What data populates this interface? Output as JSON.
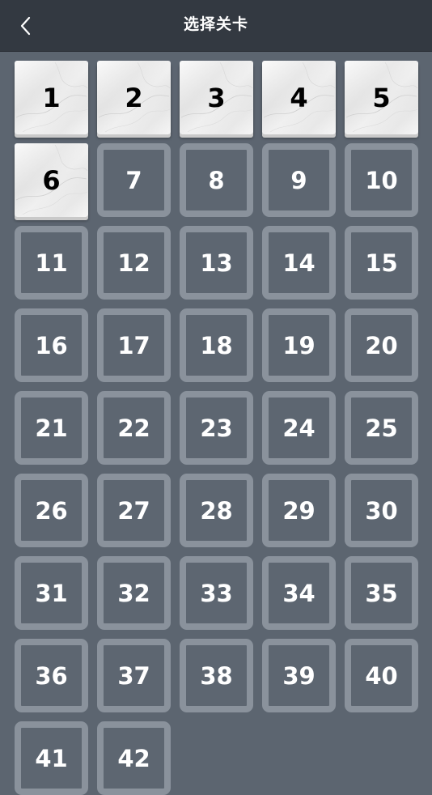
{
  "header": {
    "title": "选择关卡",
    "back_icon": "chevron-left-icon"
  },
  "colors": {
    "header_bg": "#333941",
    "page_bg": "#5c6570",
    "locked_border": "#8a929c",
    "unlocked_tile": "#f3f3f3"
  },
  "levels": [
    {
      "label": "1",
      "unlocked": true
    },
    {
      "label": "2",
      "unlocked": true
    },
    {
      "label": "3",
      "unlocked": true
    },
    {
      "label": "4",
      "unlocked": true
    },
    {
      "label": "5",
      "unlocked": true
    },
    {
      "label": "6",
      "unlocked": true
    },
    {
      "label": "7",
      "unlocked": false
    },
    {
      "label": "8",
      "unlocked": false
    },
    {
      "label": "9",
      "unlocked": false
    },
    {
      "label": "10",
      "unlocked": false
    },
    {
      "label": "11",
      "unlocked": false
    },
    {
      "label": "12",
      "unlocked": false
    },
    {
      "label": "13",
      "unlocked": false
    },
    {
      "label": "14",
      "unlocked": false
    },
    {
      "label": "15",
      "unlocked": false
    },
    {
      "label": "16",
      "unlocked": false
    },
    {
      "label": "17",
      "unlocked": false
    },
    {
      "label": "18",
      "unlocked": false
    },
    {
      "label": "19",
      "unlocked": false
    },
    {
      "label": "20",
      "unlocked": false
    },
    {
      "label": "21",
      "unlocked": false
    },
    {
      "label": "22",
      "unlocked": false
    },
    {
      "label": "23",
      "unlocked": false
    },
    {
      "label": "24",
      "unlocked": false
    },
    {
      "label": "25",
      "unlocked": false
    },
    {
      "label": "26",
      "unlocked": false
    },
    {
      "label": "27",
      "unlocked": false
    },
    {
      "label": "28",
      "unlocked": false
    },
    {
      "label": "29",
      "unlocked": false
    },
    {
      "label": "30",
      "unlocked": false
    },
    {
      "label": "31",
      "unlocked": false
    },
    {
      "label": "32",
      "unlocked": false
    },
    {
      "label": "33",
      "unlocked": false
    },
    {
      "label": "34",
      "unlocked": false
    },
    {
      "label": "35",
      "unlocked": false
    },
    {
      "label": "36",
      "unlocked": false
    },
    {
      "label": "37",
      "unlocked": false
    },
    {
      "label": "38",
      "unlocked": false
    },
    {
      "label": "39",
      "unlocked": false
    },
    {
      "label": "40",
      "unlocked": false
    },
    {
      "label": "41",
      "unlocked": false
    },
    {
      "label": "42",
      "unlocked": false
    }
  ]
}
